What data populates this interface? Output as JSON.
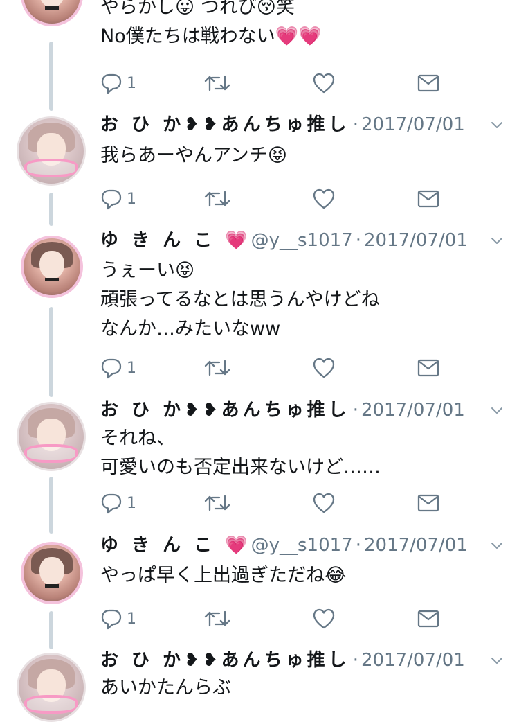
{
  "tweets": [
    {
      "author": "",
      "text_lines": [
        "やらかし😛 つれび😚笑",
        "No僕たちは戦わない💗💗"
      ],
      "reply_count": "1"
    },
    {
      "author": "お ひ か❥❥あんちゅ推し",
      "handle": "",
      "sep": "·",
      "date": "2017/07/01",
      "text_lines": [
        "我らあーやんアンチ😝"
      ],
      "reply_count": "1"
    },
    {
      "author": "ゆ き ん こ 💗",
      "handle": "@y__s1017",
      "sep": "·",
      "date": "2017/07/01",
      "text_lines": [
        "うぇーい😝",
        "頑張ってるなとは思うんやけどね",
        "なんか…みたいなww"
      ],
      "reply_count": "1"
    },
    {
      "author": "お ひ か❥❥あんちゅ推し",
      "handle": "",
      "sep": "·",
      "date": "2017/07/01",
      "text_lines": [
        "それね、",
        "可愛いのも否定出来ないけど……"
      ],
      "reply_count": "1"
    },
    {
      "author": "ゆ き ん こ 💗",
      "handle": "@y__s1017",
      "sep": "·",
      "date": "2017/07/01",
      "text_lines": [
        "やっぱ早く上出過ぎただね😂"
      ],
      "reply_count": "1"
    },
    {
      "author": "お ひ か❥❥あんちゅ推し",
      "handle": "",
      "sep": "·",
      "date": "2017/07/01",
      "text_lines": [
        "あいかたんらぶ"
      ],
      "reply_count": ""
    }
  ],
  "icons": {
    "reply": "reply-icon",
    "retweet": "retweet-icon",
    "like": "heart-icon",
    "dm": "envelope-icon",
    "more": "chevron-down-icon"
  },
  "colors": {
    "icon_gray": "#657786",
    "thread_line": "#ccd6dd",
    "avatar_ring_pink": "#f4c2dc"
  }
}
